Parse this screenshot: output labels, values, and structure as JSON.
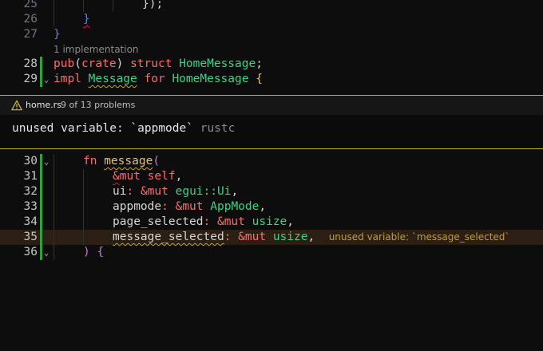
{
  "top_lines": [
    {
      "num": "25",
      "text": "});"
    },
    {
      "num": "26",
      "text": "}"
    },
    {
      "num": "27",
      "text": "}"
    }
  ],
  "codelens": "1 implementation",
  "struct_line": {
    "num": "28",
    "pub": "pub",
    "crate": "crate",
    "struct": "struct",
    "name": "HomeMessage",
    "semi": ";"
  },
  "impl_line": {
    "num": "29",
    "impl": "impl",
    "trait": "Message",
    "for": "for",
    "name": "HomeMessage",
    "brace": "{"
  },
  "peek": {
    "file": "home.rs",
    "count": "9 of 13 problems",
    "message": "unused variable: `appmode`",
    "source": "rustc",
    "icon": "warning-triangle-icon"
  },
  "fn_lines": [
    {
      "num": "30",
      "fn": "fn",
      "name": "message",
      "paren": "("
    },
    {
      "num": "31",
      "amp": "&",
      "mut": "mut",
      "self": "self",
      "comma": ","
    },
    {
      "num": "32",
      "name": "ui",
      "colon": ":",
      "amp": "&",
      "mut": "mut",
      "type": "egui::Ui",
      "comma": ","
    },
    {
      "num": "33",
      "name": "appmode",
      "colon": ":",
      "amp": "&",
      "mut": "mut",
      "type": "AppMode",
      "comma": ","
    },
    {
      "num": "34",
      "name": "page_selected",
      "colon": ":",
      "amp": "&",
      "mut": "mut",
      "type": "usize",
      "comma": ","
    },
    {
      "num": "35",
      "name": "message_selected",
      "colon": ":",
      "amp": "&",
      "mut": "mut",
      "type": "usize",
      "comma": ",",
      "hint": "unused variable: `message_selected`"
    },
    {
      "num": "36",
      "text": ") {"
    }
  ],
  "colors": {
    "warning": "#c9a227",
    "error_squiggle": "#d14",
    "keyword": "#ff6b6b",
    "type": "#3fd08a"
  }
}
